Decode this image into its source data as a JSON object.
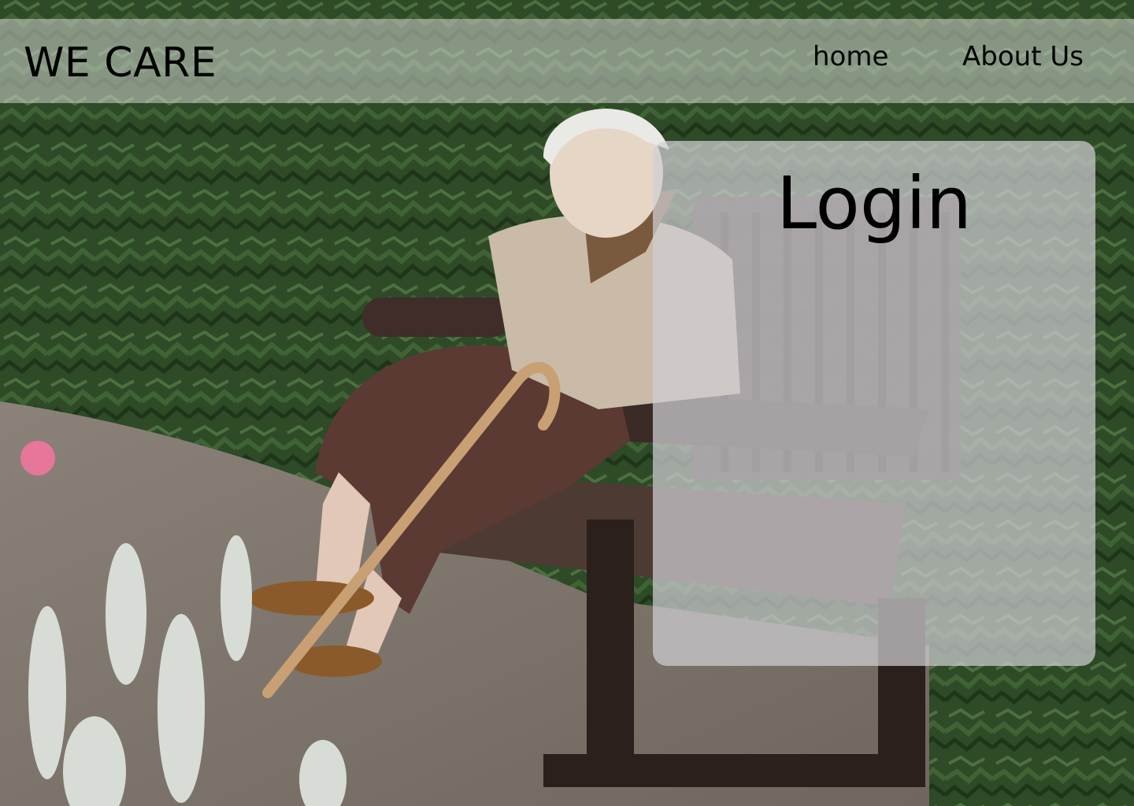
{
  "header": {
    "brand": "WE CARE",
    "nav": [
      {
        "label": "home"
      },
      {
        "label": "About Us"
      }
    ]
  },
  "login": {
    "title": "Login"
  },
  "background": {
    "subject": "photo-elderly-woman-on-park-bench"
  },
  "colors": {
    "nav_overlay": "#d2d6d0",
    "card_overlay": "#d0ced4",
    "text": "#000000"
  }
}
